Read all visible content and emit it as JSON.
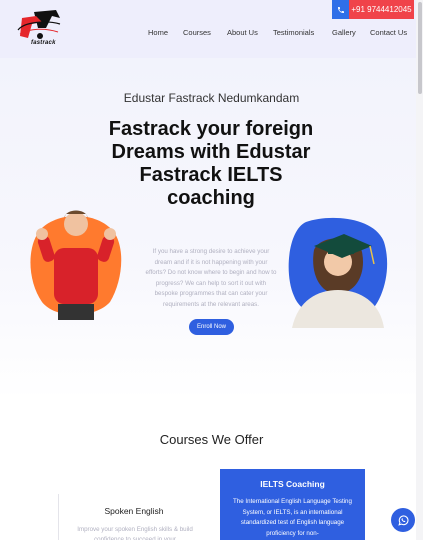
{
  "header": {
    "logo_text": "fastrack",
    "phone": "+91 9744412045",
    "nav": [
      "Home",
      "Courses",
      "About Us",
      "Testimonials",
      "Gallery",
      "Contact Us"
    ]
  },
  "hero": {
    "kicker": "Edustar Fastrack Nedumkandam",
    "title": "Fastrack your foreign Dreams with Edustar Fastrack IELTS coaching",
    "description": "If you have a strong desire to achieve your dream and if it is not happening with your efforts? Do not know where to begin and how to progress? We can help to sort it out with bespoke programmes that can cater your requirements at the relevant areas.",
    "cta": "Enroll Now"
  },
  "courses": {
    "title": "Courses We Offer",
    "cards": [
      {
        "title": "Spoken English",
        "desc": "Improve your spoken English skills & build confidence to succeed in your"
      },
      {
        "title": "IELTS Coaching",
        "desc": "The International English Language Testing System, or IELTS, is an international standardized test of English language proficiency for non-"
      }
    ]
  },
  "colors": {
    "accent_blue": "#2f5fe0",
    "phone_red": "#f0434a",
    "blob_orange": "#ff7a2e",
    "hero_bg": "#eeeefc"
  },
  "icons": [
    "phone-icon",
    "whatsapp-icon"
  ]
}
